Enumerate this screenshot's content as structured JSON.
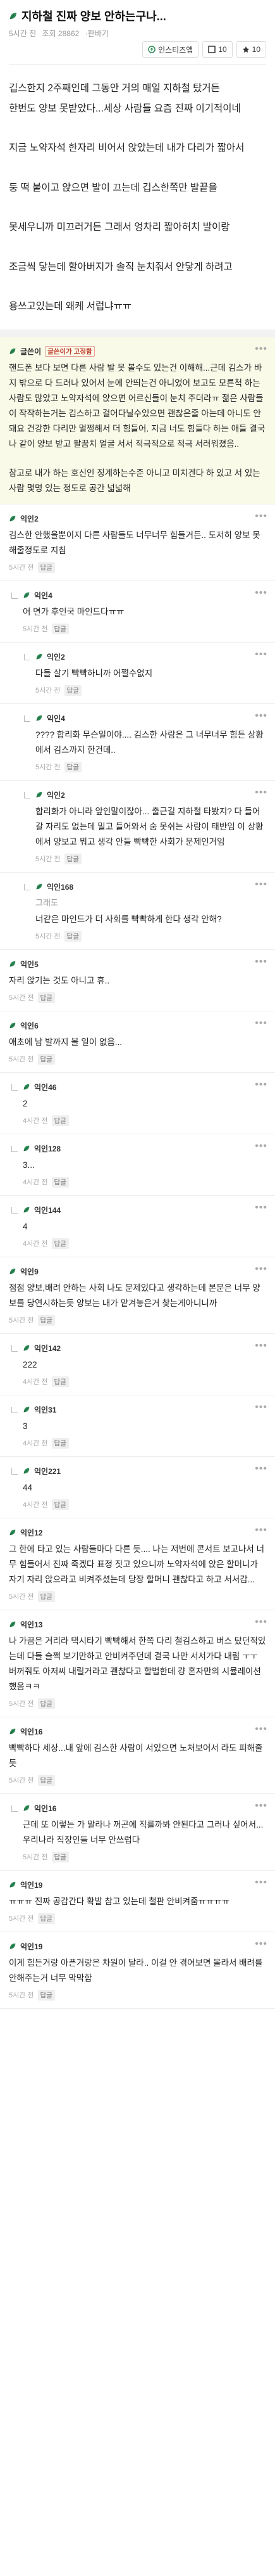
{
  "post": {
    "title": "지하철 진짜 양보 안하는구나...",
    "meta": {
      "time": "5시간 전",
      "views": "조회 28862",
      "extra": "·판바기"
    },
    "share_label": "인스티즈앱",
    "like_count": "10",
    "scrap_count": "10",
    "body": [
      "깁스한지 2주째인데 그동안 거의 매일 지하철 탔거든",
      "한번도 양보 못받았다...세상 사람들 요즘 진짜 이기적이네",
      "",
      "지금 노약자석 한자리 비어서 앉았는데 내가 다리가 짧아서",
      "",
      "둥 떡 붙이고 앉으면 발이 끄는데 깁스한쪽만 발끝을",
      "",
      "못세우니까 미끄러거든 그래서 엉차리 짧아허치 발이랑",
      "",
      "조금씩 닿는데 할아버지가 솔직 눈치줘서 안닿게 하려고",
      "",
      "용쓰고있는데 왜케 서럽냐ㅠㅠ"
    ]
  },
  "comments": [
    {
      "author": "글쓴이",
      "badge": "글쓴이가 고정함",
      "highlight": true,
      "level": 0,
      "text": [
        "핸드폰 보다 보면 다른 사람 발 못 볼수도 있는건 이해해...근데 김스가 바지 밖으로 다 드러나 있어서 눈에 안띄는건 아니었어 보고도 모른척 하는 사람도 많았고 노약자석에 앉으면 어르신들이 눈치 주더라ㅠ 젊은 사람들이 작작하는거는 김스하고 걸어다닐수있으면 괜찮은줄 아는데 아니도 안돼요 건강한 다리만 멀쩡해서 더 힘들어. 지금 너도 힘들다 하는 애들 결국 나 같이 양보 받고 팔꿈치 얼굴 서서 적극적으로 적극 서러워졌음..",
        "",
        "참고로 내가 하는 호신인 징계하는수준 아니고 미치겐다 하 있고 서 있는 사람 몇명 있는 정도로 공간 넓넓해"
      ],
      "time": "",
      "reply": ""
    },
    {
      "author": "익인2",
      "level": 0,
      "text": [
        "김스한 안했을뿐이지 다른 사람들도 너무너무 힘들거든.. 도저히 양보 못해줄정도로 지침"
      ],
      "time": "5시간 전",
      "reply": "답글"
    },
    {
      "author": "익인4",
      "level": 1,
      "text": [
        "어 면가 후인국 마인드다ㅠㅠ"
      ],
      "time": "5시간 전",
      "reply": "답글"
    },
    {
      "author": "익인2",
      "level": 2,
      "text": [
        "다들 살기 빡빡하니까 어쩔수없지"
      ],
      "time": "5시간 전",
      "reply": "답글"
    },
    {
      "author": "익인4",
      "level": 2,
      "text": [
        "???? 합리화 무슨일이야.... 김스한 사람은 그 너무너무 힘든 상황에서 김스까지 한건데.."
      ],
      "time": "5시간 전",
      "reply": "답글"
    },
    {
      "author": "익인2",
      "level": 2,
      "text": [
        "합리화가 아니라 앞인말이잖아... 출근길 지하철 타봤지? 다 들어갈 자리도 없는데 밀고 들어와서 숨 못쉬는 사람이 태반임 이 상황에서 양보고 뭐고 생각 안들 빡빡한 사회가 문제인거임"
      ],
      "time": "5시간 전",
      "reply": "답글"
    },
    {
      "author": "익인168",
      "level": 2,
      "sub": "그래도",
      "text": [
        "너같은 마인드가 더 사회를 빡빡하게 한다 생각 안해?"
      ],
      "time": "5시간 전",
      "reply": "답글"
    },
    {
      "author": "익인5",
      "level": 0,
      "text": [
        "자리 앉기는 것도 아니고 휴.."
      ],
      "time": "5시간 전",
      "reply": "답글"
    },
    {
      "author": "익인6",
      "level": 0,
      "text": [
        "애초에 남 발까지 볼 일이 없음..."
      ],
      "time": "5시간 전",
      "reply": "답글"
    },
    {
      "author": "익인46",
      "level": 1,
      "text": [
        "2"
      ],
      "time": "4시간 전",
      "reply": "답글"
    },
    {
      "author": "익인128",
      "level": 1,
      "text": [
        "3..."
      ],
      "time": "4시간 전",
      "reply": "답글"
    },
    {
      "author": "익인144",
      "level": 1,
      "text": [
        "4"
      ],
      "time": "4시간 전",
      "reply": "답글"
    },
    {
      "author": "익인9",
      "level": 0,
      "text": [
        "점점 양보,배려 안하는 사회 나도 문제있다고 생각하는데 본문은 너무 양보를 당연시하는듯 양보는 내가 맡겨놓은거 찾는게아니니까"
      ],
      "time": "5시간 전",
      "reply": "답글"
    },
    {
      "author": "익인142",
      "level": 1,
      "text": [
        "222"
      ],
      "time": "4시간 전",
      "reply": "답글"
    },
    {
      "author": "익인31",
      "level": 1,
      "text": [
        "3"
      ],
      "time": "4시간 전",
      "reply": "답글"
    },
    {
      "author": "익인221",
      "level": 1,
      "text": [
        "44"
      ],
      "time": "4시간 전",
      "reply": "답글"
    },
    {
      "author": "익인12",
      "level": 0,
      "text": [
        "그 한에 타고 있는 사람들마다 다른 듯.... 나는 저번에 콘서트 보고나서 너무 힘들어서 진짜 죽겠다 표정 짓고 있으니까 노약자석에 앉은 할머니가 자기 자리 앉으라고 비켜주셨는데 당장 할머니 괜찮다고 하고 서서감..."
      ],
      "time": "5시간 전",
      "reply": "답글"
    },
    {
      "author": "익인13",
      "level": 0,
      "text": [
        "나 가끔은 거리라 택시타기 빡빡해서 한쪽 다리 철김스하고 버스 탔던적있는데 다들 슬쩍 보기만하고 안비켜주던데 결국 나만 서서가다 내림 ㅜㅜ 버꺼줘도 아저씨 내릴거라고 괜찮다고 할법한데 걍 혼자만의 시뮬레이션했음ㅋㅋ"
      ],
      "time": "5시간 전",
      "reply": "답글"
    },
    {
      "author": "익인16",
      "level": 0,
      "text": [
        "빡빡하다 세상...내 앞에 김스한 사람이 서있으면 노처보어서 라도 피해줄듯"
      ],
      "time": "5시간 전",
      "reply": "답글"
    },
    {
      "author": "익인16",
      "level": 1,
      "text": [
        "근데 또 이렇는 가 말라나 꺼곤에 직를까봐 안된다고 그러나 싶어서...우리나라 직장인들 너무 안쓰럽다"
      ],
      "time": "5시간 전",
      "reply": "답글"
    },
    {
      "author": "익인19",
      "level": 0,
      "text": [
        "ㅠㅠㅠ 진짜 공감간다 확발 참고 있는데 철판 안비켜줌ㅠㅠㅠㅠ"
      ],
      "time": "5시간 전",
      "reply": "답글"
    },
    {
      "author": "익인19",
      "level": 0,
      "text": [
        "이게 힘든거랑 아픈거랑은 차원이 달라.. 이걸 안 겪어보면 몰라서 배려를 안해주는거 너무 막막함"
      ],
      "time": "5시간 전",
      "reply": "답글"
    }
  ],
  "colors": {
    "leaf": "#2e8b57",
    "badge": "#c0392b",
    "highlight": "#f9fbe8"
  },
  "icons": {
    "leaf": "leaf-icon",
    "share": "share-icon",
    "like": "like-icon",
    "scrap": "scrap-icon",
    "more": "more-icon",
    "reply": "reply-arrow-icon"
  }
}
